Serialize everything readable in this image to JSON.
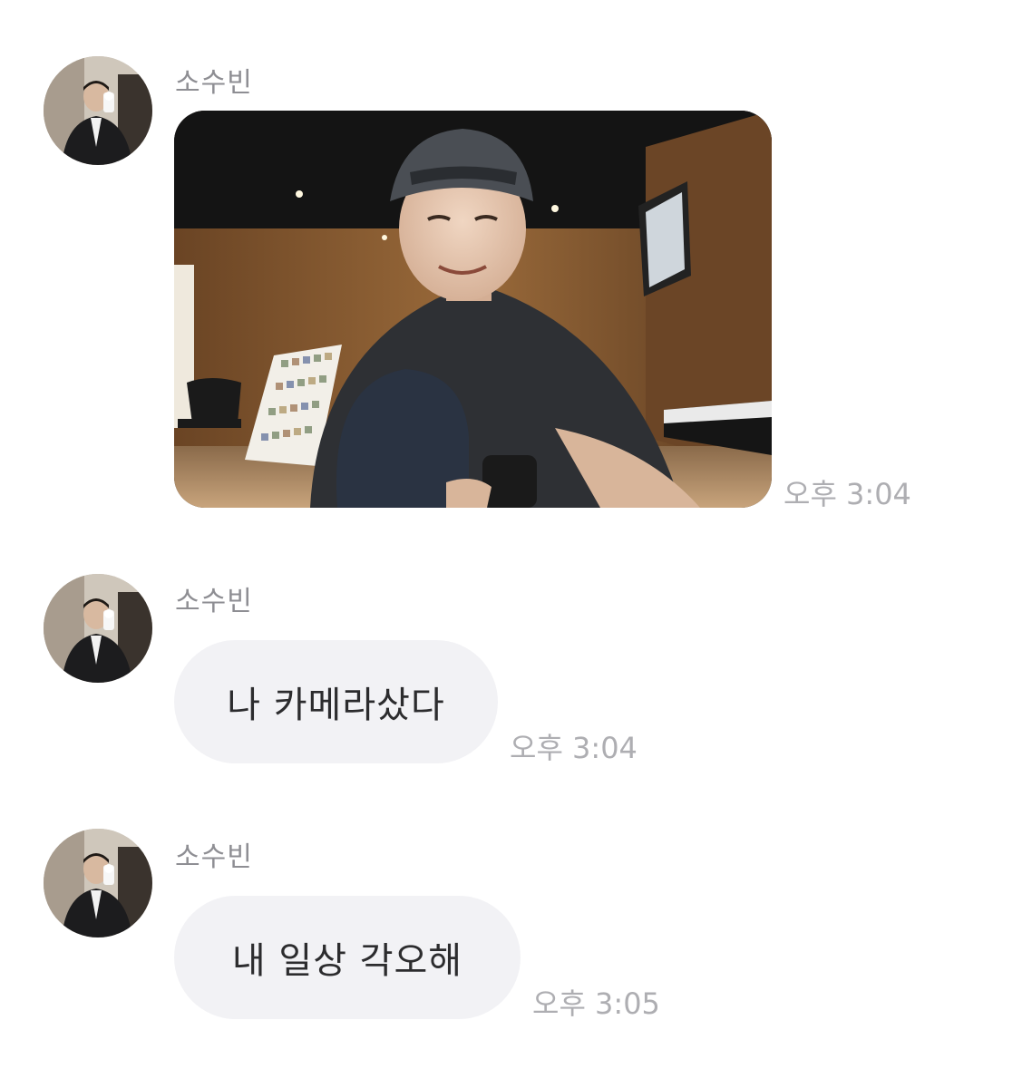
{
  "messages": [
    {
      "sender": "소수빈",
      "type": "image",
      "time": "오후 3:04"
    },
    {
      "sender": "소수빈",
      "type": "text",
      "text": "나 카메라샀다",
      "time": "오후 3:04"
    },
    {
      "sender": "소수빈",
      "type": "text",
      "text": "내 일상 각오해",
      "time": "오후 3:05"
    }
  ],
  "colors": {
    "bubble_background": "#f2f2f5",
    "sender_text": "#8e8e93",
    "time_text": "#aeaeb2",
    "message_text": "#2c2c2e"
  }
}
